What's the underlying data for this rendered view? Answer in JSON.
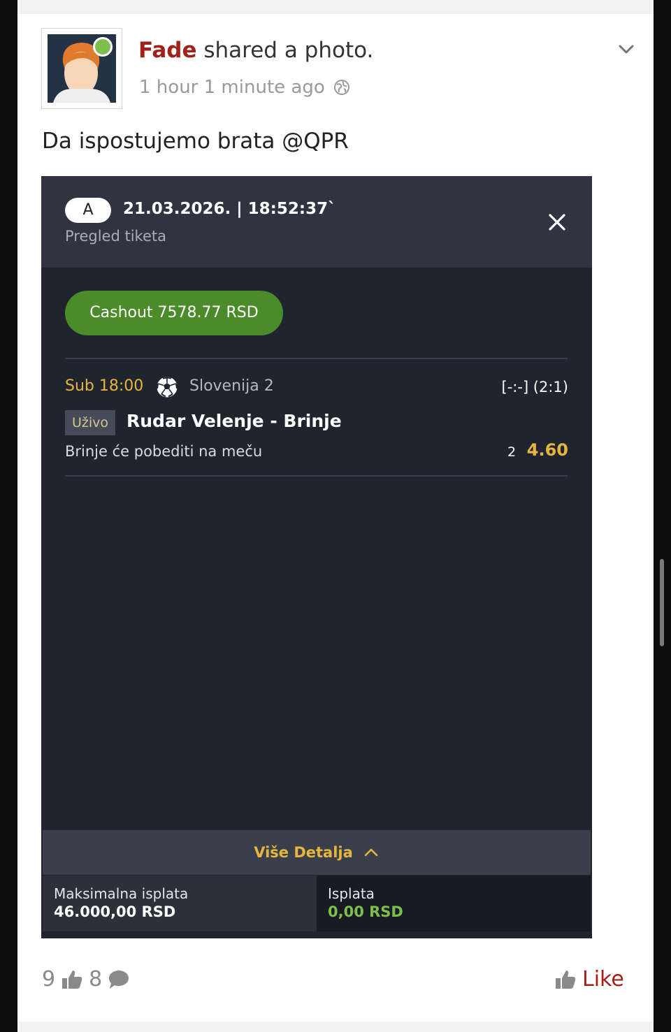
{
  "post": {
    "author": "Fade",
    "action": " shared a photo.",
    "timestamp": "1 hour 1 minute ago",
    "privacy_icon": "globe-icon",
    "caption": "Da ispostujemo brata @QPR",
    "colors": {
      "author": "#a1221b",
      "online": "#7cc04b"
    }
  },
  "ticket": {
    "badge": "A",
    "datetime": "21.03.2026. | 18:52:37`",
    "subtitle": "Pregled tiketa",
    "cashout_label": "Cashout 7578.77 RSD",
    "match": {
      "time": "Sub 18:00",
      "sport_icon": "soccer-ball-icon",
      "league": "Slovenija 2",
      "score": "[-:-] (2:1)",
      "live_label": "Uživo",
      "teams": "Rudar Velenje - Brinje",
      "pick": "Brinje će pobediti na meču",
      "selection": "2",
      "odds": "4.60"
    },
    "details_label": "Više Detalja",
    "max_payout": {
      "label": "Maksimalna isplata",
      "value": "46.000,00 RSD"
    },
    "payout": {
      "label": "Isplata",
      "value": "0,00 RSD"
    },
    "colors": {
      "accent": "#e6b63c",
      "cashout": "#4b8b2a",
      "payout_value": "#7cc04b",
      "background": "#20242e"
    }
  },
  "footer": {
    "likes_count": "9",
    "comments_count": "8",
    "like_label": "Like"
  }
}
